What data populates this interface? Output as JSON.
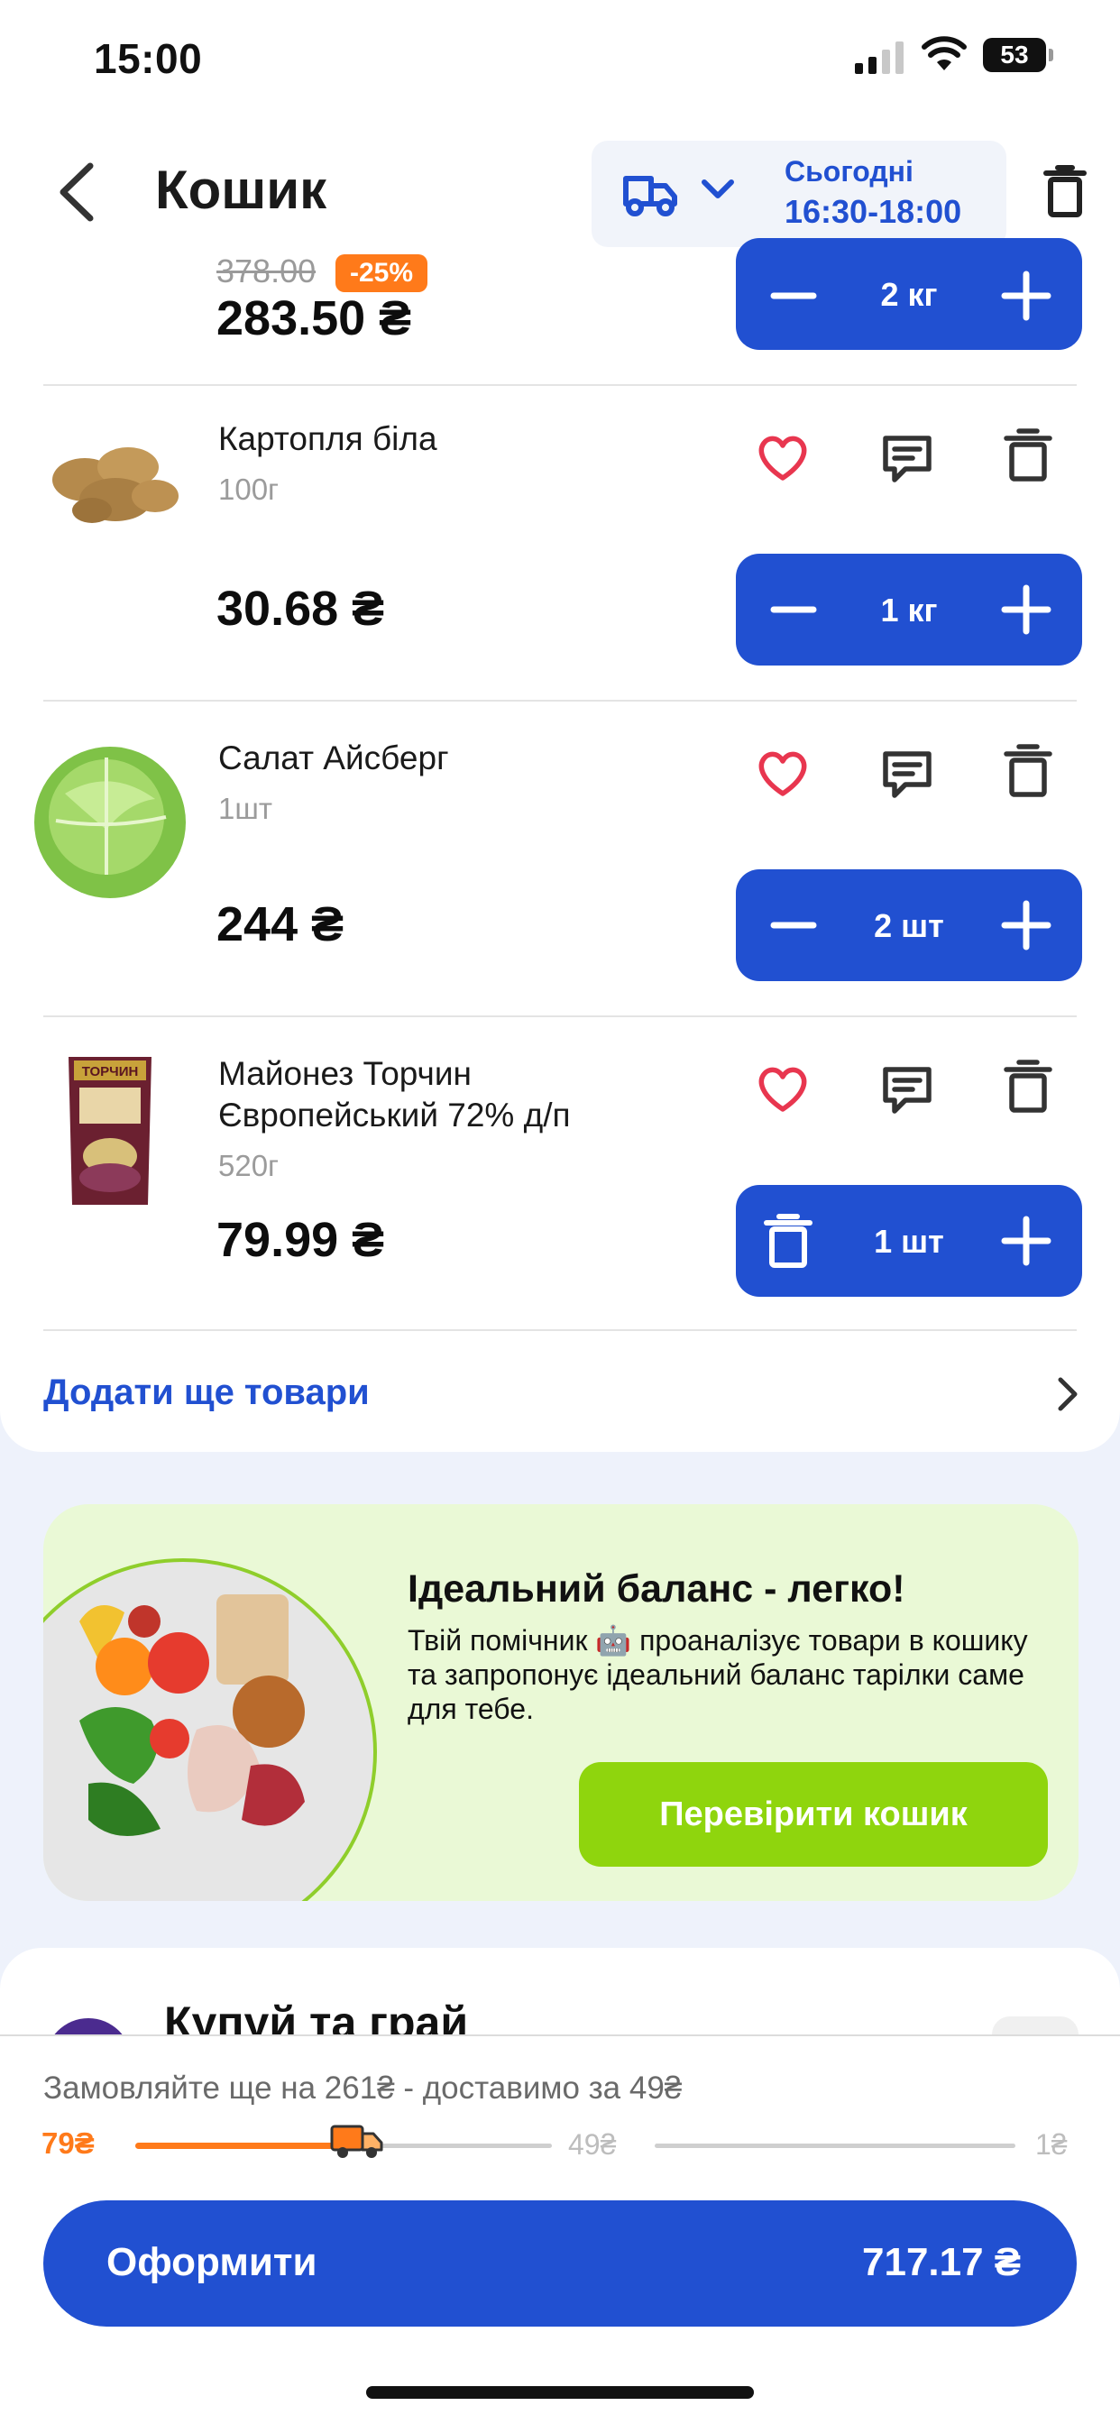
{
  "status_bar": {
    "time": "15:00",
    "battery": "53"
  },
  "header": {
    "title": "Кошик",
    "slot_day": "Сьогодні",
    "slot_time": "16:30-18:00"
  },
  "cart": {
    "partial_item": {
      "old_price": "378.00",
      "discount": "-25%",
      "price": "283.50 ₴",
      "qty": "2 кг"
    },
    "items": [
      {
        "name": "Картопля біла",
        "weight": "100г",
        "price": "30.68 ₴",
        "qty": "1 кг"
      },
      {
        "name": "Салат Айсберг",
        "weight": "1шт",
        "price": "244 ₴",
        "qty": "2 шт"
      },
      {
        "name_line1": "Майонез Торчин",
        "name_line2": "Європейський 72% д/п",
        "weight": "520г",
        "price": "79.99 ₴",
        "qty": "1 шт",
        "image_label": "ТОРЧИН"
      }
    ],
    "add_more": "Додати ще товари"
  },
  "promo": {
    "title": "Ідеальний баланс - легко!",
    "text": "Твій помічник 🤖 проаналізує товари в кошику та запропонує ідеальний баланс тарілки саме для тебе.",
    "button": "Перевірити кошик"
  },
  "game": {
    "title": "Купуй та грай"
  },
  "bottom": {
    "threshold_text": "Замовляйте ще на 261₴ - доставимо за 49₴",
    "progress_start": "79₴",
    "progress_mid": "49₴",
    "progress_end": "1₴",
    "progress_fraction": 0.22,
    "checkout_label": "Оформити",
    "checkout_total": "717.17 ₴"
  },
  "colors": {
    "accent": "#2150d1",
    "orange": "#ff7a1a",
    "green": "#8fd50d",
    "heart": "#e8364f"
  }
}
